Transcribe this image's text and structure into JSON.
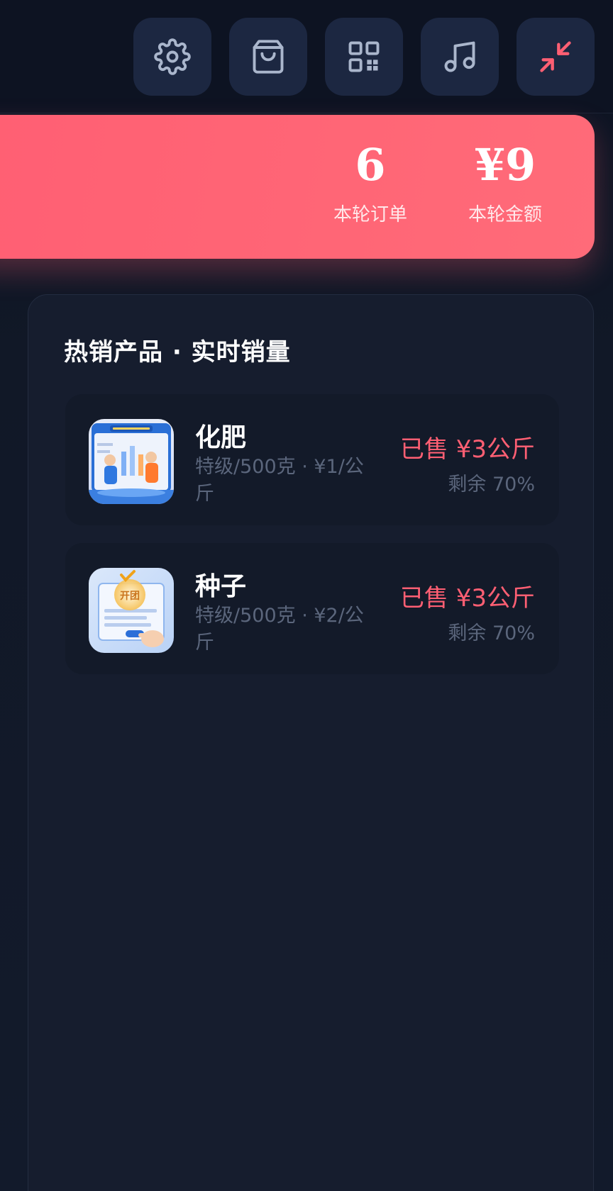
{
  "toolbar": {
    "buttons": [
      {
        "name": "settings",
        "icon": "gear-icon"
      },
      {
        "name": "shop",
        "icon": "shopping-bag-icon"
      },
      {
        "name": "qrcode",
        "icon": "qr-code-icon"
      },
      {
        "name": "music",
        "icon": "music-note-icon"
      },
      {
        "name": "minimize",
        "icon": "minimize-arrows-icon"
      }
    ]
  },
  "stats": {
    "orders_value": "6",
    "orders_label": "本轮订单",
    "amount_value": "¥9",
    "amount_label": "本轮金额"
  },
  "panel": {
    "title": "热销产品 · 实时销量",
    "products": [
      {
        "name": "化肥",
        "desc": "特级/500克 · ¥1/公斤",
        "sold": "已售 ¥3公斤",
        "remain": "剩余 70%",
        "thumb_icon": "team-pk-leaderboard-image"
      },
      {
        "name": "种子",
        "desc": "特级/500克 · ¥2/公斤",
        "sold": "已售 ¥3公斤",
        "remain": "剩余 70%",
        "thumb_icon": "group-sign-up-image",
        "thumb_text": "开团"
      }
    ]
  },
  "colors": {
    "accent": "#ff5f73",
    "background": "#111827",
    "button": "#1c2741",
    "muted_text": "#5b667c"
  }
}
